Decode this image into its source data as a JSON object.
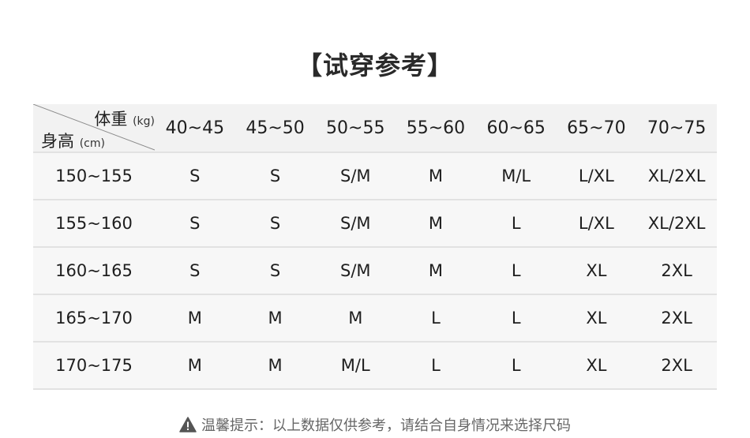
{
  "title": "【试穿参考】",
  "table": {
    "corner": {
      "weight_label": "体重",
      "weight_unit": "(kg)",
      "height_label": "身高",
      "height_unit": "(cm)"
    },
    "weight_columns": [
      "40~45",
      "45~50",
      "50~55",
      "55~60",
      "60~65",
      "65~70",
      "70~75"
    ],
    "rows": [
      {
        "height": "150~155",
        "sizes": [
          "S",
          "S",
          "S/M",
          "M",
          "M/L",
          "L/XL",
          "XL/2XL"
        ]
      },
      {
        "height": "155~160",
        "sizes": [
          "S",
          "S",
          "S/M",
          "M",
          "L",
          "L/XL",
          "XL/2XL"
        ]
      },
      {
        "height": "160~165",
        "sizes": [
          "S",
          "S",
          "S/M",
          "M",
          "L",
          "XL",
          "2XL"
        ]
      },
      {
        "height": "165~170",
        "sizes": [
          "M",
          "M",
          "M",
          "L",
          "L",
          "XL",
          "2XL"
        ]
      },
      {
        "height": "170~175",
        "sizes": [
          "M",
          "M",
          "M/L",
          "L",
          "L",
          "XL",
          "2XL"
        ]
      }
    ]
  },
  "footer": {
    "icon": "warning-icon",
    "text": "温馨提示：以上数据仅供参考，请结合自身情况来选择尺码"
  },
  "colors": {
    "header_bg": "#f2f2f2",
    "row_bg": "#f7f7f7",
    "divider": "#e2e2e2",
    "text": "#1e1e1e",
    "note_text": "#666666"
  }
}
